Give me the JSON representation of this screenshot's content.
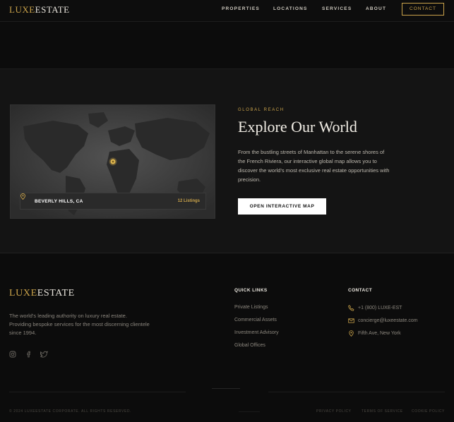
{
  "brand": {
    "part1": "LUXE",
    "part2": "ESTATE"
  },
  "nav": {
    "links": [
      "PROPERTIES",
      "LOCATIONS",
      "SERVICES",
      "ABOUT"
    ],
    "contact_label": "CONTACT"
  },
  "map_section": {
    "eyebrow": "GLOBAL REACH",
    "headline": "Explore Our World",
    "description": "From the bustling streets of Manhattan to the serene shores of the French Riviera, our interactive global map allows you to discover the world's most exclusive real estate opportunities with precision.",
    "button_label": "OPEN INTERACTIVE MAP",
    "location_card": {
      "name": "BEVERLY HILLS, CA",
      "count": "12 Listings"
    }
  },
  "footer": {
    "logo": {
      "part1": "LUXE",
      "part2": "ESTATE"
    },
    "description": "The world's leading authority on luxury real estate. Providing bespoke services for the most discerning clientele since 1994.",
    "socials": [
      "instagram-icon",
      "facebook-icon",
      "twitter-icon"
    ],
    "quick_links": {
      "title": "QUICK LINKS",
      "items": [
        "Private Listings",
        "Commercial Assets",
        "Investment Advisory",
        "Global Offices"
      ]
    },
    "contact": {
      "title": "CONTACT",
      "items": [
        {
          "icon": "phone-icon",
          "text": "+1 (800) LUXE-EST"
        },
        {
          "icon": "mail-icon",
          "text": "concierge@luxeestate.com"
        },
        {
          "icon": "map-pin-icon",
          "text": "Fifth Ave, New York"
        }
      ]
    },
    "copyright": "© 2024 LUXEESTATE CORPORATE. ALL RIGHTS RESERVED.",
    "legal_links": [
      "PRIVACY POLICY",
      "TERMS OF SERVICE",
      "COOKIE POLICY"
    ]
  },
  "colors": {
    "accent": "#c9a24a",
    "background": "#0c0c0c",
    "section": "#141414"
  }
}
